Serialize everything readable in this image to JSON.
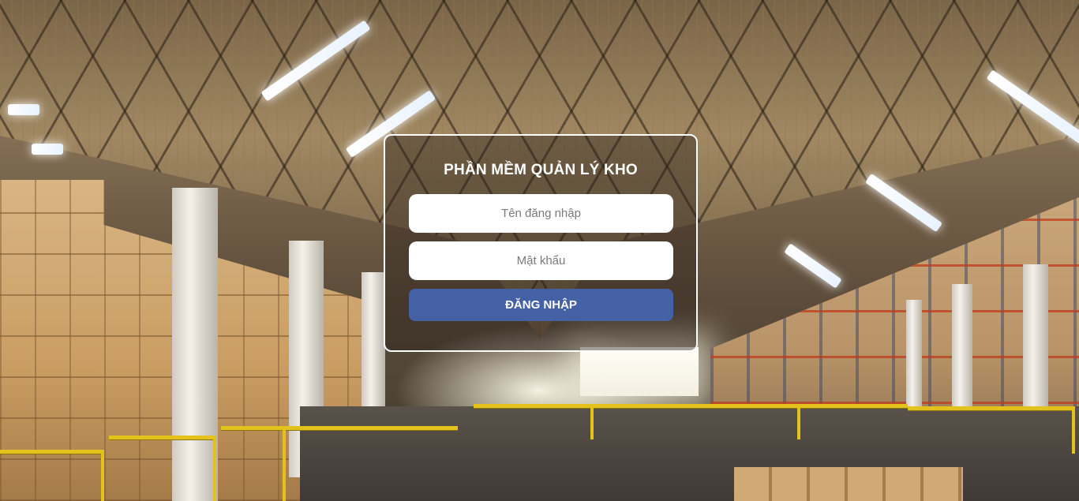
{
  "login": {
    "title": "PHẦN MỀM QUẢN LÝ KHO",
    "username_placeholder": "Tên đăng nhập",
    "username_value": "",
    "password_placeholder": "Mật khẩu",
    "password_value": "",
    "submit_label": "ĐĂNG NHẬP"
  },
  "background": {
    "image": "warehouse-photo"
  },
  "colors": {
    "button": "#4461a6",
    "card_border": "#ffffff",
    "title_text": "#ffffff"
  }
}
